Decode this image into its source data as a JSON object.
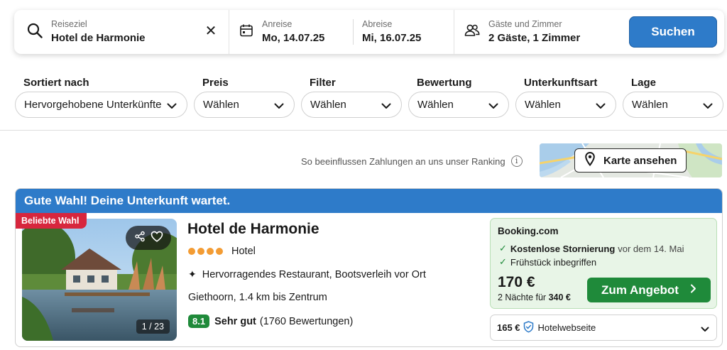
{
  "search": {
    "destination_label": "Reiseziel",
    "destination_value": "Hotel de Harmonie",
    "clear_icon": "close-icon",
    "checkin_label": "Anreise",
    "checkin_value": "Mo, 14.07.25",
    "checkout_label": "Abreise",
    "checkout_value": "Mi, 16.07.25",
    "guests_label": "Gäste und Zimmer",
    "guests_value": "2 Gäste, 1 Zimmer",
    "search_button": "Suchen"
  },
  "filters": [
    {
      "label": "Sortiert nach",
      "value": "Hervorgehobene Unterkünfte"
    },
    {
      "label": "Preis",
      "value": "Wählen"
    },
    {
      "label": "Filter",
      "value": "Wählen"
    },
    {
      "label": "Bewertung",
      "value": "Wählen"
    },
    {
      "label": "Unterkunftsart",
      "value": "Wählen"
    },
    {
      "label": "Lage",
      "value": "Wählen"
    }
  ],
  "ranking": {
    "text": "So beeinflussen Zahlungen an uns unser Ranking",
    "info_icon": "i"
  },
  "map": {
    "button_label": "Karte ansehen"
  },
  "card": {
    "banner": "Gute Wahl! Deine Unterkunft wartet.",
    "badge": "Beliebte Wahl",
    "photo_counter": "1 / 23",
    "name": "Hotel de Harmonie",
    "stars": 4,
    "type": "Hotel",
    "highlight": "Hervorragendes Restaurant, Bootsverleih vor Ort",
    "location": "Giethoorn, 1.4 km bis Zentrum",
    "rating_score": "8.1",
    "rating_label": "Sehr gut",
    "rating_count": "(1760 Bewertungen)",
    "offer": {
      "provider": "Booking.com",
      "perk1_bold": "Kostenlose Stornierung",
      "perk1_rest": "vor dem 14. Mai",
      "perk2": "Frühstück inbegriffen",
      "price": "170 €",
      "nights_text": "2 Nächte für",
      "nights_total": "340 €",
      "cta": "Zum Angebot"
    },
    "alt_offer": {
      "price": "165 €",
      "label": "Hotelwebseite"
    }
  },
  "colors": {
    "brand_blue": "#2e7bc9",
    "green": "#1f8a3a",
    "badge_red": "#d7263d",
    "star_orange": "#f39c34"
  }
}
